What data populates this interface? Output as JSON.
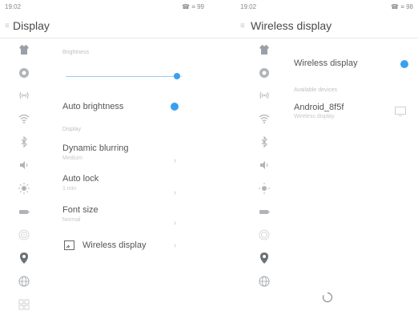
{
  "accent_color": "#3aa0ee",
  "left": {
    "status_time": "19:02",
    "status_icons": "☎ ≡ 99",
    "title": "Display",
    "brightness_label": "Brightness",
    "brightness_value_percent": 95,
    "auto_brightness": {
      "label": "Auto brightness",
      "on": true
    },
    "display_section": "Display",
    "dynamic_blurring": {
      "label": "Dynamic blurring",
      "value": "Medium"
    },
    "auto_lock": {
      "label": "Auto lock",
      "value": "1 min"
    },
    "font_size": {
      "label": "Font size",
      "value": "Normal"
    },
    "wireless_display": {
      "label": "Wireless display"
    }
  },
  "right": {
    "status_time": "19:02",
    "status_icons": "☎ ≡ 98",
    "title": "Wireless display",
    "wireless_display": {
      "label": "Wireless display",
      "on": true
    },
    "available_devices_label": "Available devices",
    "device": {
      "name": "Android_8f5f",
      "status": "Wireless display"
    }
  },
  "sidebar_icons": [
    "shirt-icon",
    "location-icon",
    "sim-signal-icon",
    "wifi-icon",
    "bluetooth-icon",
    "volume-icon",
    "brightness-sun-icon",
    "battery-icon",
    "fingerprint-icon",
    "location-pin-icon",
    "globe-icon",
    "apps-grid-icon"
  ]
}
